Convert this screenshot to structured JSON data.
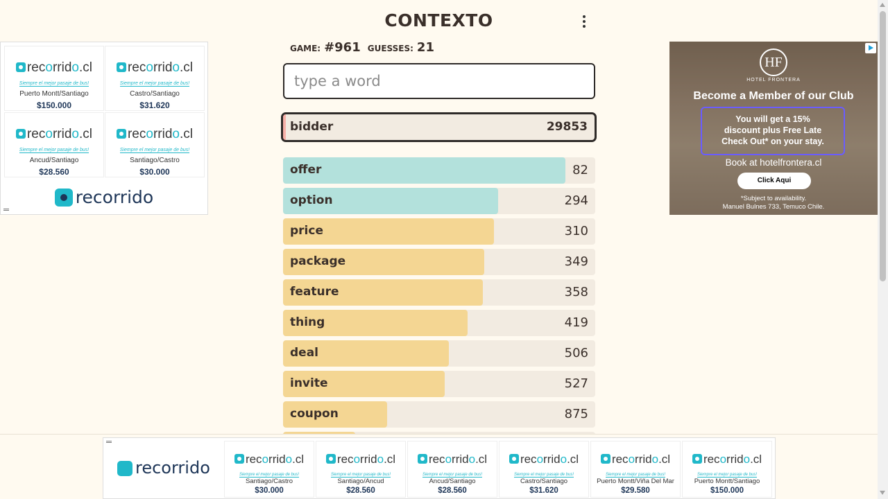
{
  "app": {
    "title": "CONTEXTO",
    "menu_icon": "kebab-menu-icon"
  },
  "game_info": {
    "game_label": "GAME:",
    "game_value": "#961",
    "guesses_label": "GUESSES:",
    "guesses_value": "21"
  },
  "input": {
    "placeholder": "type a word",
    "value": ""
  },
  "last_guess": {
    "word": "bidder",
    "rank": "29853"
  },
  "guesses": [
    {
      "word": "offer",
      "rank": "82",
      "fill": 0.905,
      "color": "#b3e1dc"
    },
    {
      "word": "option",
      "rank": "294",
      "fill": 0.688,
      "color": "#b3e1dc"
    },
    {
      "word": "price",
      "rank": "310",
      "fill": 0.676,
      "color": "#f4d693"
    },
    {
      "word": "package",
      "rank": "349",
      "fill": 0.644,
      "color": "#f4d693"
    },
    {
      "word": "feature",
      "rank": "358",
      "fill": 0.64,
      "color": "#f4d693"
    },
    {
      "word": "thing",
      "rank": "419",
      "fill": 0.591,
      "color": "#f4d693"
    },
    {
      "word": "deal",
      "rank": "506",
      "fill": 0.531,
      "color": "#f4d693"
    },
    {
      "word": "invite",
      "rank": "527",
      "fill": 0.518,
      "color": "#f4d693"
    },
    {
      "word": "coupon",
      "rank": "875",
      "fill": 0.333,
      "color": "#f4d693"
    },
    {
      "word": "",
      "rank": "",
      "fill": 0.23,
      "color": "#f4d693"
    }
  ],
  "ads": {
    "left": {
      "logo_text_a": "rec",
      "logo_text_o": "o",
      "logo_text_b": "rrid",
      "logo_text_o2": "o",
      "logo_text_c": ".cl",
      "tagline": "Siempre el mejor pasaje de bus!",
      "cells": [
        {
          "route": "Puerto Montt/Santiago",
          "price": "$150.000"
        },
        {
          "route": "Castro/Santiago",
          "price": "$31.620"
        },
        {
          "route": "Ancud/Santiago",
          "price": "$28.560"
        },
        {
          "route": "Santiago/Castro",
          "price": "$30.000"
        }
      ],
      "brand": "recorrido"
    },
    "right": {
      "logo": "HF",
      "logo_sub": "HOTEL FRONTERA",
      "headline": "Become a Member of our Club",
      "offer_line1": "You will get a 15%",
      "offer_line2": "discount plus Free Late",
      "offer_line3": "Check Out* on your stay.",
      "book": "Book at hotelfrontera.cl",
      "button": "Click Aqui",
      "note1": "*Subject to availability.",
      "note2": "Manuel Bulnes 733, Temuco Chile."
    },
    "bottom": {
      "brand": "recorrido",
      "cells": [
        {
          "route": "Santiago/Castro",
          "price": "$30.000"
        },
        {
          "route": "Santiago/Ancud",
          "price": "$28.560"
        },
        {
          "route": "Ancud/Santiago",
          "price": "$28.560"
        },
        {
          "route": "Castro/Santiago",
          "price": "$31.620"
        },
        {
          "route": "Puerto Montt/Viña Del Mar",
          "price": "$29.580"
        },
        {
          "route": "Puerto Montt/Santiago",
          "price": "$150.000"
        }
      ]
    }
  }
}
